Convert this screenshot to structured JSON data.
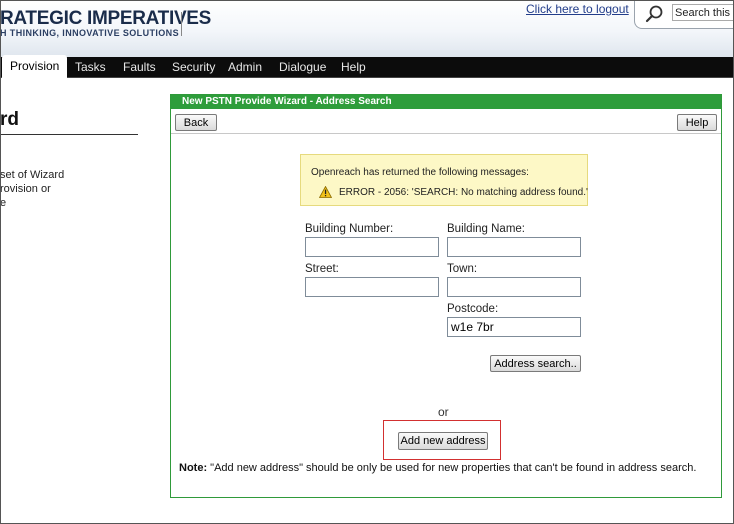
{
  "header": {
    "brand": "RATEGIC IMPERATIVES",
    "tagline": "H THINKING, INNOVATIVE SOLUTIONS",
    "logout_link": "Click here to logout",
    "search_placeholder": "Search this p"
  },
  "nav": {
    "items": [
      {
        "label": "Provision",
        "active": true
      },
      {
        "label": "Tasks"
      },
      {
        "label": "Faults"
      },
      {
        "label": "Security"
      },
      {
        "label": "Admin"
      },
      {
        "label": "Dialogue"
      },
      {
        "label": "Help"
      }
    ]
  },
  "left_panel": {
    "title": "rd",
    "description": "set of Wizard\nrovision or\ne"
  },
  "wizard": {
    "title": "New PSTN Provide Wizard - Address Search",
    "back_label": "Back",
    "help_label": "Help",
    "messages_heading": "Openreach has returned the following messages:",
    "error_text": "ERROR - 2056: 'SEARCH: No matching address found.'",
    "fields": {
      "building_number": {
        "label": "Building Number:",
        "value": ""
      },
      "building_name": {
        "label": "Building Name:",
        "value": ""
      },
      "street": {
        "label": "Street:",
        "value": ""
      },
      "town": {
        "label": "Town:",
        "value": ""
      },
      "postcode": {
        "label": "Postcode:",
        "value": "w1e 7br"
      }
    },
    "address_search_label": "Address search..",
    "or_text": "or",
    "add_new_label": "Add new address",
    "note_label": "Note:",
    "note_text": " \"Add new address\" should be only be used for new properties that can't be found in address search."
  },
  "colors": {
    "wizard_green": "#2e9d3b",
    "navbar": "#0c0c0c",
    "message_bg": "#fdf8c6",
    "highlight_red": "#d23030"
  },
  "icons": [
    "search-icon",
    "warning-icon"
  ]
}
